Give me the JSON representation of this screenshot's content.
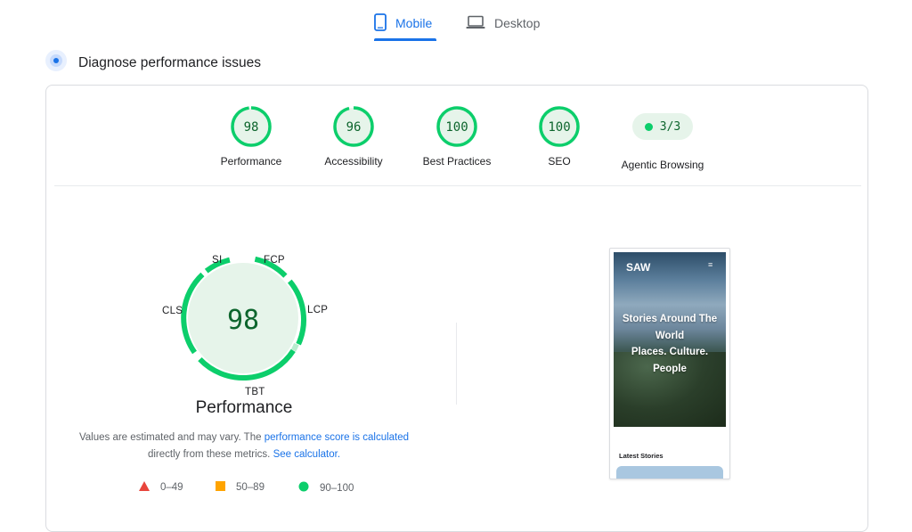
{
  "tabs": [
    {
      "label": "Mobile",
      "icon": "smartphone-icon",
      "active": true
    },
    {
      "label": "Desktop",
      "icon": "laptop-icon",
      "active": false
    }
  ],
  "diagnose": {
    "title": "Diagnose performance issues"
  },
  "scores": [
    {
      "label": "Performance",
      "value": "98",
      "fraction": 0.98
    },
    {
      "label": "Accessibility",
      "value": "96",
      "fraction": 0.96
    },
    {
      "label": "Best Practices",
      "value": "100",
      "fraction": 1.0
    },
    {
      "label": "SEO",
      "value": "100",
      "fraction": 1.0
    }
  ],
  "agentic": {
    "label": "Agentic Browsing",
    "value": "3/3"
  },
  "performance_gauge": {
    "value": "98",
    "title": "Performance",
    "metrics": {
      "si": "SI",
      "fcp": "FCP",
      "lcp": "LCP",
      "tbt": "TBT",
      "cls": "CLS"
    }
  },
  "description": {
    "text1": "Values are estimated and may vary. The ",
    "link1": "performance score is calculated",
    "text2": "directly from these metrics. ",
    "link2": "See calculator."
  },
  "legend": [
    {
      "range": "0–49",
      "color": "#e8453c",
      "shape": "triangle"
    },
    {
      "range": "50–89",
      "color": "#ffa400",
      "shape": "square"
    },
    {
      "range": "90–100",
      "color": "#0cce6b",
      "shape": "circle"
    }
  ],
  "screenshot": {
    "brand": "SAW",
    "menu": "≡",
    "headline_line1": "Stories Around The",
    "headline_line2": "World",
    "headline_line3": "Places. Culture.",
    "headline_line4": "People",
    "latest": "Latest Stories"
  },
  "colors": {
    "accent": "#1a73e8",
    "pass_green": "#0cce6b",
    "pass_bg": "#e6f4ea",
    "pass_text": "#0d652d"
  }
}
